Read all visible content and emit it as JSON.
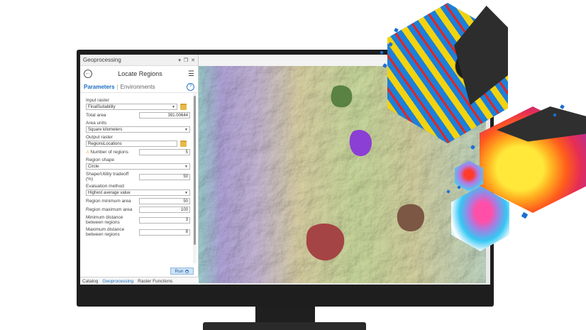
{
  "pane": {
    "title": "Geoprocessing",
    "pin": "▾",
    "restore": "❐",
    "close": "✕",
    "tool_title": "Locate Regions",
    "tabs": {
      "parameters": "Parameters",
      "separator": "|",
      "environments": "Environments"
    }
  },
  "params": {
    "input_raster": {
      "label": "Input raster",
      "value": "FinalSuitability"
    },
    "total_area": {
      "label": "Total area",
      "value": "391.00644"
    },
    "area_units": {
      "label": "Area units",
      "value": "Square kilometers"
    },
    "output_raster": {
      "label": "Output raster",
      "value": "RegionsLocations"
    },
    "num_regions": {
      "label": "Number of regions",
      "value": "5"
    },
    "region_shape": {
      "label": "Region shape",
      "value": "Circle"
    },
    "tradeoff": {
      "label_1": "Shape/Utility tradeoff",
      "label_2": "(%)",
      "value": "50"
    },
    "evaluation_method": {
      "label": "Evaluation method",
      "value": "Highest average value"
    },
    "region_min_area": {
      "label": "Region minimum area",
      "value": "50"
    },
    "region_max_area": {
      "label": "Region maximum area",
      "value": "100"
    },
    "min_distance": {
      "label_1": "Minimum distance",
      "label_2": "between regions",
      "value": "3"
    },
    "max_distance": {
      "label_1": "Maximum distance",
      "label_2": "between regions",
      "value": "8"
    }
  },
  "run_label": "Run",
  "bottom_tabs": [
    "Catalog",
    "Geoprocessing",
    "Raster Functions"
  ],
  "colors": {
    "accent": "#1a6ec2",
    "region_dark_green": "#4f7a3a",
    "region_purple": "#8b3fd4",
    "region_brown": "#7b5744",
    "region_red": "#a54444"
  }
}
